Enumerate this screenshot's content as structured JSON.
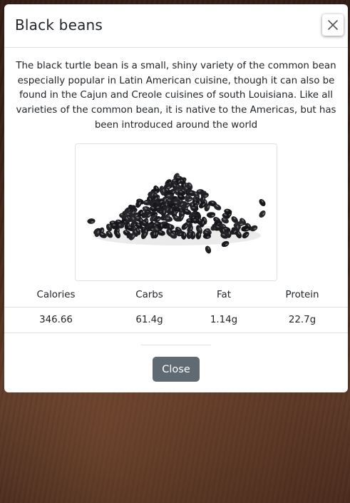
{
  "modal": {
    "title": "Black beans",
    "close_icon": "close-icon",
    "description": "The black turtle bean is a small, shiny variety of the common bean especially popular in Latin American cuisine, though it can also be found in the Cajun and Creole cuisines of south Louisiana. Like all varieties of the common bean, it is native to the Americas, but has been introduced around the world",
    "image_subject": "pile of black beans",
    "nutrition": {
      "headers": [
        "Calories",
        "Carbs",
        "Fat",
        "Protein"
      ],
      "values": [
        "346.66",
        "61.4g",
        "1.14g",
        "22.7g"
      ]
    },
    "close_button_label": "Close"
  },
  "colors": {
    "button_bg": "#5f6a72",
    "border": "#dee2e6",
    "text": "#212529",
    "backdrop": "#4a2b1d"
  }
}
